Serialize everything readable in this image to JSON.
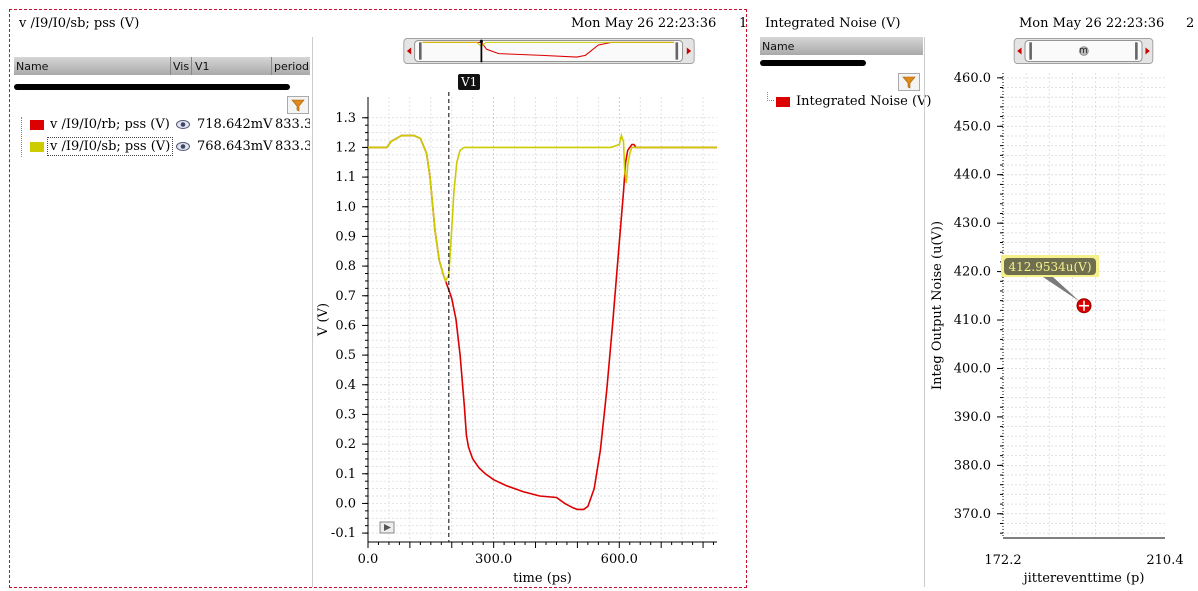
{
  "left_panel": {
    "title": "v /I9/I0/sb; pss (V)",
    "datetime": "Mon May 26 22:23:36",
    "subwindow_index": "1",
    "table_headers": [
      "Name",
      "Vis",
      "V1",
      "period"
    ],
    "rows": [
      {
        "name": "v /I9/I0/rb; pss (V)",
        "value": "718.642mV",
        "period": "833.3",
        "color": "#dd0000",
        "visible_icon": "eye-icon"
      },
      {
        "name": "v /I9/I0/sb; pss (V)",
        "value": "768.643mV",
        "period": "833.3",
        "color": "#cccc00",
        "visible_icon": "eye-icon"
      }
    ],
    "marker_label": "V1",
    "y_axis_label": "V (V)",
    "x_axis_label": "time (ps)"
  },
  "right_panel": {
    "title": "Integrated Noise (V)",
    "datetime": "Mon May 26 22:23:36",
    "subwindow_index": "2",
    "table_header": "Name",
    "legend_entry": "Integrated Noise (V)",
    "legend_color": "#dd0000",
    "point_label": "412.9534u(V)",
    "y_axis_label": "Integ Output Noise (u(V))",
    "x_axis_label": "jittereventtime (p)",
    "scrollbar_label": "m"
  },
  "chart_data": [
    {
      "type": "line",
      "xlabel": "time (ps)",
      "ylabel": "V (V)",
      "xlim": [
        0,
        833.3
      ],
      "ylim": [
        -0.13,
        1.37
      ],
      "x_ticks": [
        "0.0",
        "300.0",
        "600.0"
      ],
      "x_tick_values": [
        0,
        300,
        600
      ],
      "y_ticks": [
        "1.3",
        "1.2",
        "1.1",
        "1.0",
        "0.9",
        "0.8",
        "0.7",
        "0.6",
        "0.5",
        "0.4",
        "0.3",
        "0.2",
        "0.1",
        "0.0",
        "-0.1"
      ],
      "y_tick_values": [
        1.3,
        1.2,
        1.1,
        1.0,
        0.9,
        0.8,
        0.7,
        0.6,
        0.5,
        0.4,
        0.3,
        0.2,
        0.1,
        0.0,
        -0.1
      ],
      "grid": true,
      "marker": {
        "name": "V1",
        "x": 193
      },
      "series": [
        {
          "name": "v /I9/I0/rb; pss (V)",
          "color": "#dd0000",
          "x": [
            0,
            45,
            55,
            80,
            95,
            110,
            125,
            140,
            148,
            160,
            170,
            180,
            185,
            193,
            200,
            210,
            220,
            230,
            235,
            240,
            250,
            265,
            280,
            300,
            330,
            370,
            410,
            450,
            470,
            490,
            500,
            515,
            525,
            540,
            555,
            570,
            585,
            600,
            610,
            615,
            620,
            625,
            630,
            635,
            640,
            650,
            700,
            833
          ],
          "y": [
            1.2,
            1.2,
            1.22,
            1.24,
            1.24,
            1.24,
            1.23,
            1.18,
            1.1,
            0.92,
            0.82,
            0.77,
            0.75,
            0.72,
            0.69,
            0.62,
            0.5,
            0.33,
            0.23,
            0.19,
            0.15,
            0.12,
            0.1,
            0.08,
            0.06,
            0.04,
            0.025,
            0.02,
            0.0,
            -0.015,
            -0.02,
            -0.02,
            -0.01,
            0.05,
            0.18,
            0.38,
            0.62,
            0.88,
            1.05,
            1.15,
            1.19,
            1.2,
            1.21,
            1.21,
            1.2,
            1.2,
            1.2,
            1.2
          ]
        },
        {
          "name": "v /I9/I0/sb; pss (V)",
          "color": "#cccc00",
          "x": [
            0,
            45,
            55,
            80,
            95,
            110,
            125,
            140,
            148,
            160,
            170,
            180,
            185,
            193,
            198,
            205,
            212,
            220,
            230,
            240,
            260,
            300,
            400,
            500,
            580,
            600,
            605,
            610,
            613,
            617,
            620,
            625,
            630,
            640,
            660,
            700,
            833
          ],
          "y": [
            1.2,
            1.2,
            1.22,
            1.24,
            1.24,
            1.24,
            1.23,
            1.18,
            1.1,
            0.92,
            0.82,
            0.77,
            0.75,
            0.77,
            0.88,
            1.05,
            1.15,
            1.19,
            1.2,
            1.2,
            1.2,
            1.2,
            1.2,
            1.2,
            1.2,
            1.21,
            1.24,
            1.22,
            1.12,
            1.08,
            1.14,
            1.18,
            1.2,
            1.2,
            1.2,
            1.2,
            1.2
          ]
        }
      ]
    },
    {
      "type": "scatter",
      "xlabel": "jittereventtime (p)",
      "ylabel": "Integ Output Noise (u(V))",
      "xlim": [
        172.2,
        210.4
      ],
      "ylim": [
        365.0,
        461.0
      ],
      "x_ticks": [
        "172.2",
        "210.4"
      ],
      "x_tick_values": [
        172.2,
        210.4
      ],
      "y_ticks": [
        "460.0",
        "450.0",
        "440.0",
        "430.0",
        "420.0",
        "410.0",
        "400.0",
        "390.0",
        "380.0",
        "370.0"
      ],
      "y_tick_values": [
        460,
        450,
        440,
        430,
        420,
        410,
        400,
        390,
        380,
        370
      ],
      "grid": true,
      "series": [
        {
          "name": "Integrated Noise (V)",
          "color": "#dd0000",
          "x": [
            191.3
          ],
          "y": [
            412.9534
          ]
        }
      ]
    }
  ]
}
